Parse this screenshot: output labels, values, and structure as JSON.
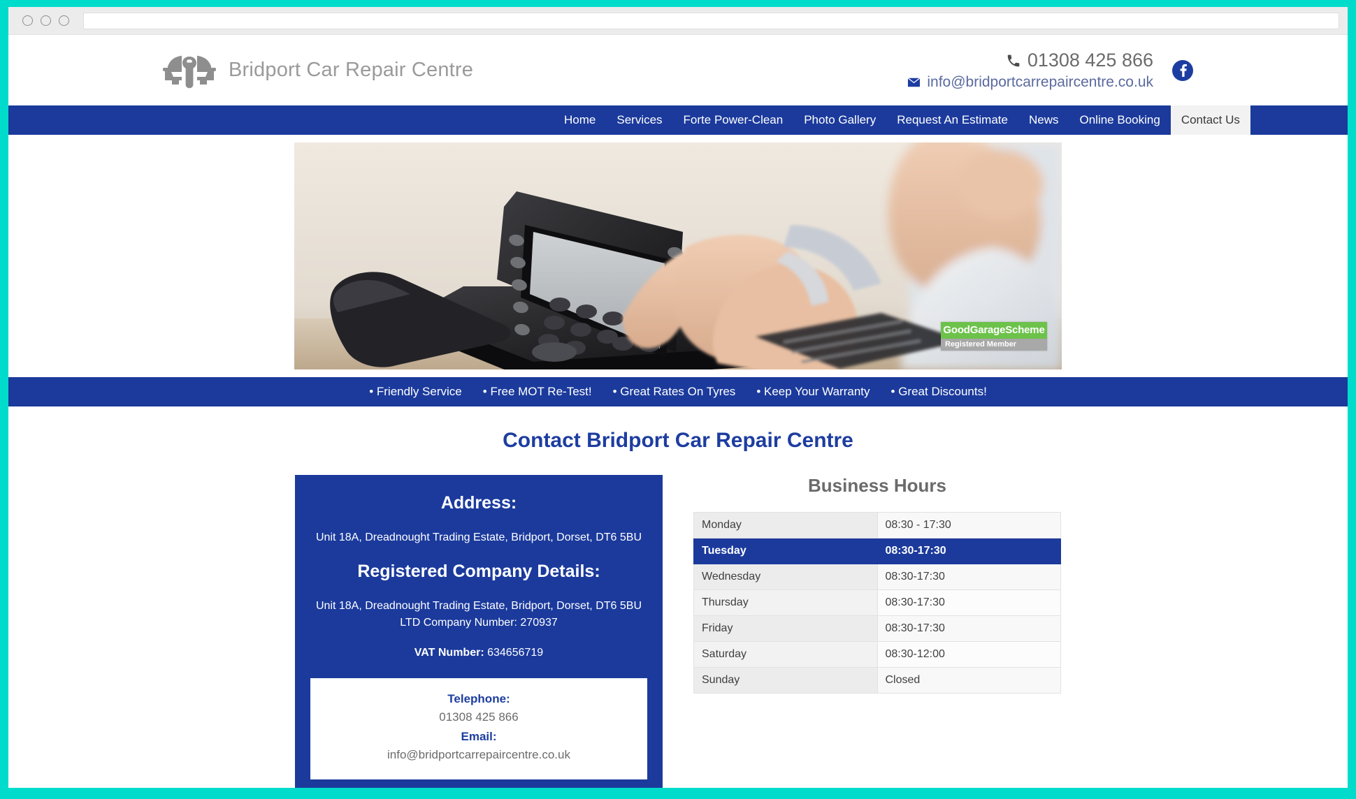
{
  "browser": {
    "url_value": "",
    "url_placeholder": "",
    "window_buttons": [
      "close-dot",
      "minimize-dot",
      "maximize-dot"
    ]
  },
  "header": {
    "logo_icon": "car-wrench-logo-icon",
    "brand_name": "Bridport Car Repair Centre",
    "phone_icon": "phone-icon",
    "phone": "01308 425 866",
    "email_icon": "envelope-icon",
    "email": "info@bridportcarrepaircentre.co.uk",
    "facebook_icon": "facebook-icon"
  },
  "nav": {
    "items": [
      {
        "label": "Home",
        "active": false
      },
      {
        "label": "Services",
        "active": false
      },
      {
        "label": "Forte Power-Clean",
        "active": false
      },
      {
        "label": "Photo Gallery",
        "active": false
      },
      {
        "label": "Request An Estimate",
        "active": false
      },
      {
        "label": "News",
        "active": false
      },
      {
        "label": "Online Booking",
        "active": false
      },
      {
        "label": "Contact Us",
        "active": true
      }
    ]
  },
  "hero": {
    "alt": "hand-dialing-desk-phone",
    "badge": {
      "title": "GoodGarageScheme",
      "subtitle": "Registered Member"
    }
  },
  "taglines": [
    "Friendly Service",
    "Free MOT Re-Test!",
    "Great Rates On Tyres",
    "Keep Your Warranty",
    "Great Discounts!"
  ],
  "main": {
    "page_title": "Contact Bridport Car Repair Centre",
    "address_panel": {
      "address_heading": "Address:",
      "address_line": "Unit 18A, Dreadnought Trading Estate, Bridport, Dorset, DT6 5BU",
      "registered_heading": "Registered Company Details:",
      "registered_address": "Unit 18A, Dreadnought Trading Estate, Bridport, Dorset, DT6 5BU",
      "company_number": "LTD Company Number: 270937",
      "vat_label": "VAT Number:",
      "vat_number": "634656719",
      "card": {
        "telephone_label": "Telephone:",
        "telephone_value": "01308 425 866",
        "email_label": "Email:",
        "email_value": "info@bridportcarrepaircentre.co.uk"
      }
    },
    "business_hours": {
      "title": "Business Hours",
      "rows": [
        {
          "day": "Monday",
          "time": "08:30 - 17:30",
          "highlight": false
        },
        {
          "day": "Tuesday",
          "time": "08:30-17:30",
          "highlight": true
        },
        {
          "day": "Wednesday",
          "time": "08:30-17:30",
          "highlight": false
        },
        {
          "day": "Thursday",
          "time": "08:30-17:30",
          "highlight": false
        },
        {
          "day": "Friday",
          "time": "08:30-17:30",
          "highlight": false
        },
        {
          "day": "Saturday",
          "time": "08:30-12:00",
          "highlight": false
        },
        {
          "day": "Sunday",
          "time": "Closed",
          "highlight": false
        }
      ]
    }
  },
  "colors": {
    "page_border_teal": "#00dccb",
    "brand_blue": "#1b3a9c",
    "link_blue": "#1d3da0",
    "logo_gray": "#9a9a9a",
    "badge_green": "#6cc24a",
    "badge_gray": "#a8a8a8"
  }
}
